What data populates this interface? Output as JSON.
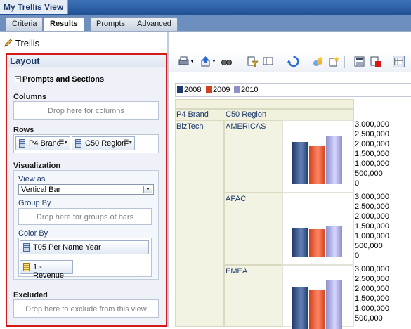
{
  "window": {
    "title": "My Trellis View"
  },
  "tabs": [
    {
      "label": "Criteria",
      "active": false
    },
    {
      "label": "Results",
      "active": true
    },
    {
      "label": "Prompts",
      "active": false
    },
    {
      "label": "Advanced",
      "active": false
    }
  ],
  "view": {
    "title": "Trellis"
  },
  "layout": {
    "title": "Layout",
    "prompts_sections": "Prompts and Sections",
    "columns": {
      "title": "Columns",
      "drop": "Drop here for columns"
    },
    "rows": {
      "title": "Rows",
      "items": [
        "P4 Brand",
        "C50 Region"
      ]
    },
    "visualization": {
      "title": "Visualization",
      "view_as_label": "View as",
      "view_as_value": "Vertical Bar",
      "group_by_label": "Group By",
      "group_by_drop": "Drop here for groups of bars",
      "color_by_label": "Color By",
      "color_by_items": [
        "T05 Per Name Year",
        "1 - Revenue"
      ]
    },
    "excluded": {
      "title": "Excluded",
      "drop": "Drop here to exclude from this view"
    }
  },
  "colors": {
    "accent_red": "#d4191a",
    "series_2008": "#1f3b6e",
    "series_2009": "#d0411e",
    "series_2010": "#8e8fc8"
  },
  "trellis": {
    "legend": [
      "2008",
      "2009",
      "2010"
    ],
    "row_headers": [
      "P4 Brand",
      "C50 Region"
    ],
    "brand": "BizTech",
    "y_ticks": [
      "3,000,000",
      "2,500,000",
      "2,000,000",
      "1,500,000",
      "1,000,000",
      "500,000",
      "0"
    ],
    "regions": [
      {
        "name": "AMERICAS",
        "values": [
          2150000,
          1950000,
          2480000
        ]
      },
      {
        "name": "APAC",
        "values": [
          1450000,
          1400000,
          1520000
        ]
      },
      {
        "name": "EMEA",
        "values": [
          2150000,
          1950000,
          2480000
        ]
      }
    ]
  },
  "chart_data": {
    "type": "bar",
    "categories": [
      "2008",
      "2009",
      "2010"
    ],
    "series": [
      {
        "name": "AMERICAS",
        "values": [
          2150000,
          1950000,
          2480000
        ]
      },
      {
        "name": "APAC",
        "values": [
          1450000,
          1400000,
          1520000
        ]
      },
      {
        "name": "EMEA",
        "values": [
          2150000,
          1950000,
          2480000
        ]
      }
    ],
    "ylim": [
      0,
      3000000
    ]
  }
}
